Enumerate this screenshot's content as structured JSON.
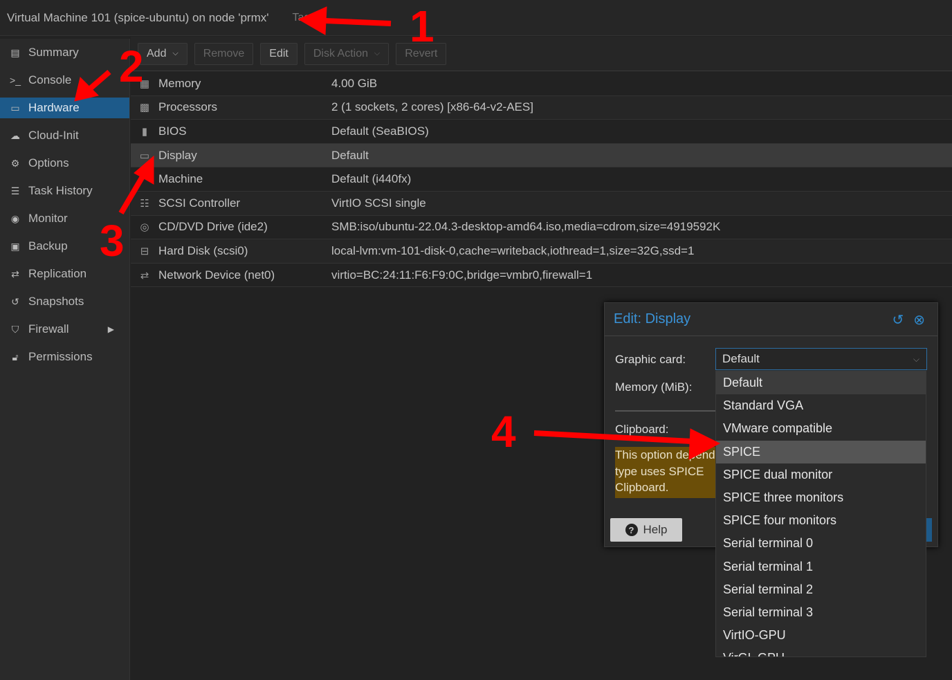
{
  "header": {
    "title": "Virtual Machine 101 (spice-ubuntu) on node 'prmx'",
    "tags": "Tags"
  },
  "sidebar": {
    "items": [
      {
        "label": "Summary",
        "icon": "book-icon"
      },
      {
        "label": "Console",
        "icon": "terminal-icon"
      },
      {
        "label": "Hardware",
        "icon": "monitor-icon",
        "active": true
      },
      {
        "label": "Cloud-Init",
        "icon": "cloud-icon"
      },
      {
        "label": "Options",
        "icon": "gear-icon"
      },
      {
        "label": "Task History",
        "icon": "list-icon"
      },
      {
        "label": "Monitor",
        "icon": "eye-icon"
      },
      {
        "label": "Backup",
        "icon": "floppy-icon"
      },
      {
        "label": "Replication",
        "icon": "retweet-icon"
      },
      {
        "label": "Snapshots",
        "icon": "history-icon"
      },
      {
        "label": "Firewall",
        "icon": "shield-icon"
      },
      {
        "label": "Permissions",
        "icon": "unlock-icon"
      }
    ]
  },
  "toolbar": {
    "add": "Add",
    "remove": "Remove",
    "edit": "Edit",
    "disk_action": "Disk Action",
    "revert": "Revert"
  },
  "hardware": [
    {
      "name": "Memory",
      "value": "4.00 GiB"
    },
    {
      "name": "Processors",
      "value": "2 (1 sockets, 2 cores) [x86-64-v2-AES]"
    },
    {
      "name": "BIOS",
      "value": "Default (SeaBIOS)"
    },
    {
      "name": "Display",
      "value": "Default"
    },
    {
      "name": "Machine",
      "value": "Default (i440fx)"
    },
    {
      "name": "SCSI Controller",
      "value": "VirtIO SCSI single"
    },
    {
      "name": "CD/DVD Drive (ide2)",
      "value": "SMB:iso/ubuntu-22.04.3-desktop-amd64.iso,media=cdrom,size=4919592K"
    },
    {
      "name": "Hard Disk (scsi0)",
      "value": "local-lvm:vm-101-disk-0,cache=writeback,iothread=1,size=32G,ssd=1"
    },
    {
      "name": "Network Device (net0)",
      "value": "virtio=BC:24:11:F6:F9:0C,bridge=vmbr0,firewall=1"
    }
  ],
  "dialog": {
    "title": "Edit: Display",
    "graphic_card_label": "Graphic card:",
    "graphic_card_value": "Default",
    "memory_label": "Memory (MiB):",
    "clipboard_label": "Clipboard:",
    "warning_lines": [
      "This option depend",
      "type uses SPICE",
      "Clipboard."
    ],
    "help": "Help"
  },
  "dropdown": {
    "options": [
      "Default",
      "Standard VGA",
      "VMware compatible",
      "SPICE",
      "SPICE dual monitor",
      "SPICE three monitors",
      "SPICE four monitors",
      "Serial terminal 0",
      "Serial terminal 1",
      "Serial terminal 2",
      "Serial terminal 3",
      "VirtIO-GPU",
      "VirGL GPU"
    ],
    "hovered": "SPICE"
  },
  "annotations": [
    "1",
    "2",
    "3",
    "4"
  ],
  "colors": {
    "accent": "#1d5a8a",
    "annotation": "#ff0000",
    "warning": "#6b4e08"
  }
}
